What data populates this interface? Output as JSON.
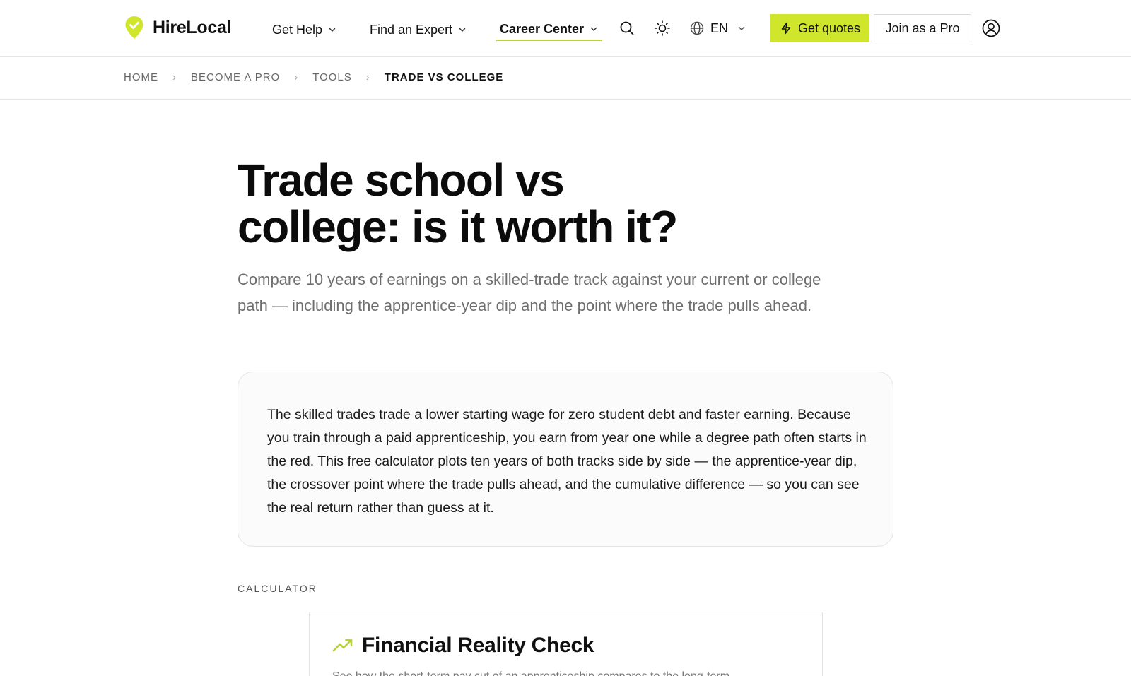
{
  "header": {
    "brand": "HireLocal",
    "nav": [
      {
        "label": "Get Help"
      },
      {
        "label": "Find an Expert"
      },
      {
        "label": "Career Center"
      }
    ],
    "language": "EN",
    "cta_primary": "Get quotes",
    "cta_secondary": "Join as a Pro",
    "accent_color": "#cfe62d"
  },
  "breadcrumb": [
    "HOME",
    "BECOME A PRO",
    "TOOLS",
    "TRADE VS COLLEGE"
  ],
  "page": {
    "title_line1": "Trade school vs",
    "title_line2": "college: is it worth it?",
    "subtitle": "Compare 10 years of earnings on a skilled-trade track against your current or college path — including the apprentice-year dip and the point where the trade pulls ahead.",
    "intro": "The skilled trades trade a lower starting wage for zero student debt and faster earning. Because you train through a paid apprenticeship, you earn from year one while a degree path often starts in the red. This free calculator plots ten years of both tracks side by side — the apprentice-year dip, the crossover point where the trade pulls ahead, and the cumulative difference — so you can see the real return rather than guess at it.",
    "section_label": "CALCULATOR"
  },
  "calculator": {
    "title": "Financial Reality Check",
    "description": "See how the short-term pay cut of an apprenticeship compares to the long-term"
  }
}
